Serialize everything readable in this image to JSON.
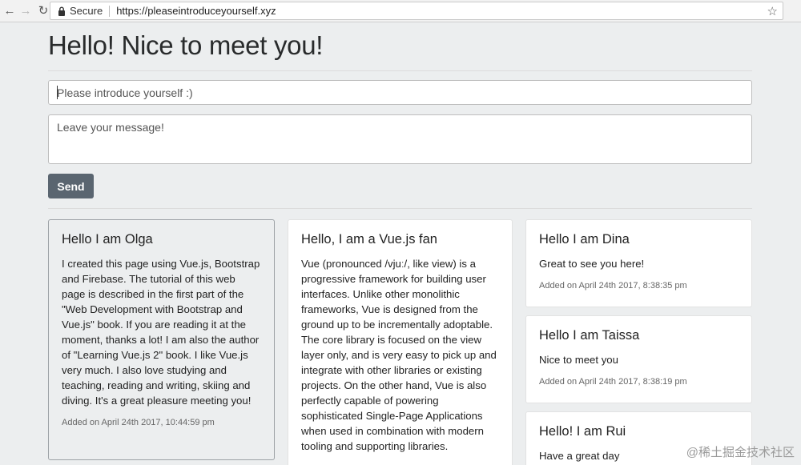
{
  "browser": {
    "secure_label": "Secure",
    "url": "https://pleaseintroduceyourself.xyz"
  },
  "page": {
    "title": "Hello! Nice to meet you!",
    "name_placeholder": "Please introduce yourself :)",
    "message_placeholder": "Leave your message!",
    "send_label": "Send"
  },
  "cards": [
    {
      "title": "Hello I am Olga",
      "text": "I created this page using Vue.js, Bootstrap and Firebase. The tutorial of this web page is described in the first part of the \"Web Development with Bootstrap and Vue.js\" book. If you are reading it at the moment, thanks a lot! I am also the author of \"Learning Vue.js 2\" book. I like Vue.js very much. I also love studying and teaching, reading and writing, skiing and diving. It's a great pleasure meeting you!",
      "meta": "Added on April 24th 2017, 10:44:59 pm"
    },
    {
      "title": "Hello, I am a Vue.js fan",
      "text": "Vue (pronounced /vjuː/, like view) is a progressive framework for building user interfaces. Unlike other monolithic frameworks, Vue is designed from the ground up to be incrementally adoptable. The core library is focused on the view layer only, and is very easy to pick up and integrate with other libraries or existing projects. On the other hand, Vue is also perfectly capable of powering sophisticated Single-Page Applications when used in combination with modern tooling and supporting libraries."
    },
    {
      "title": "Hello I am Dina",
      "text": "Great to see you here!",
      "meta": "Added on April 24th 2017, 8:38:35 pm"
    },
    {
      "title": "Hello I am Taissa",
      "text": "Nice to meet you",
      "meta": "Added on April 24th 2017, 8:38:19 pm"
    },
    {
      "title": "Hello! I am Rui",
      "text": "Have a great day"
    }
  ],
  "watermark": "@稀土掘金技术社区"
}
